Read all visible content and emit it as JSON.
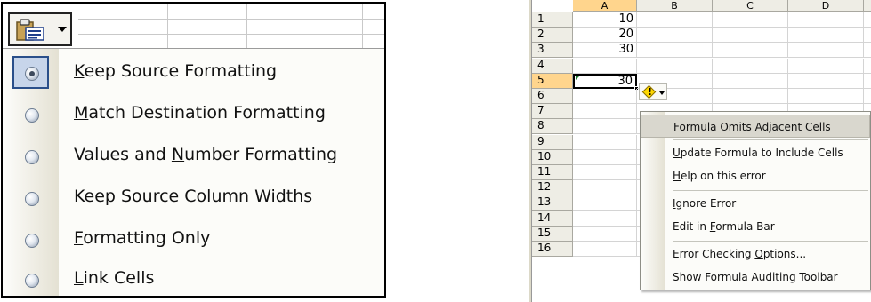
{
  "paste_options": {
    "button_icon": "clipboard-paste-icon",
    "items": [
      {
        "pre": "",
        "key": "K",
        "post": "eep Source Formatting",
        "checked": true
      },
      {
        "pre": "",
        "key": "M",
        "post": "atch Destination Formatting",
        "checked": false
      },
      {
        "pre": "Values and ",
        "key": "N",
        "post": "umber Formatting",
        "checked": false
      },
      {
        "pre": "Keep Source Column ",
        "key": "W",
        "post": "idths",
        "checked": false
      },
      {
        "pre": "",
        "key": "F",
        "post": "ormatting Only",
        "checked": false
      },
      {
        "pre": "",
        "key": "L",
        "post": "ink Cells",
        "checked": false
      }
    ]
  },
  "sheet": {
    "columns": [
      "A",
      "B",
      "C",
      "D"
    ],
    "active_column": "A",
    "active_row": "5",
    "rows": [
      {
        "num": "1",
        "a": "10"
      },
      {
        "num": "2",
        "a": "20"
      },
      {
        "num": "3",
        "a": "30"
      },
      {
        "num": "4",
        "a": ""
      },
      {
        "num": "5",
        "a": "30"
      },
      {
        "num": "6",
        "a": ""
      },
      {
        "num": "7",
        "a": ""
      },
      {
        "num": "8",
        "a": ""
      },
      {
        "num": "9",
        "a": ""
      },
      {
        "num": "10",
        "a": ""
      },
      {
        "num": "11",
        "a": ""
      },
      {
        "num": "12",
        "a": ""
      },
      {
        "num": "13",
        "a": ""
      },
      {
        "num": "14",
        "a": ""
      },
      {
        "num": "15",
        "a": ""
      },
      {
        "num": "16",
        "a": ""
      }
    ],
    "error_icon": "warning-diamond-icon",
    "error_glyph": "!"
  },
  "error_menu": {
    "items": [
      {
        "pre": "Formula Omits Adjacent Cells",
        "key": "",
        "post": ""
      },
      {
        "pre": "",
        "key": "U",
        "post": "pdate Formula to Include Cells"
      },
      {
        "pre": "",
        "key": "H",
        "post": "elp on this error"
      },
      {
        "pre": "",
        "key": "I",
        "post": "gnore Error"
      },
      {
        "pre": "Edit in ",
        "key": "F",
        "post": "ormula Bar"
      },
      {
        "pre": "Error Checking ",
        "key": "O",
        "post": "ptions..."
      },
      {
        "pre": "",
        "key": "S",
        "post": "how Formula Auditing Toolbar"
      }
    ]
  },
  "colors": {
    "selection_highlight": "#c7d5ea",
    "active_header": "#ffd58d",
    "menu_hover": "#d9d7ce"
  }
}
